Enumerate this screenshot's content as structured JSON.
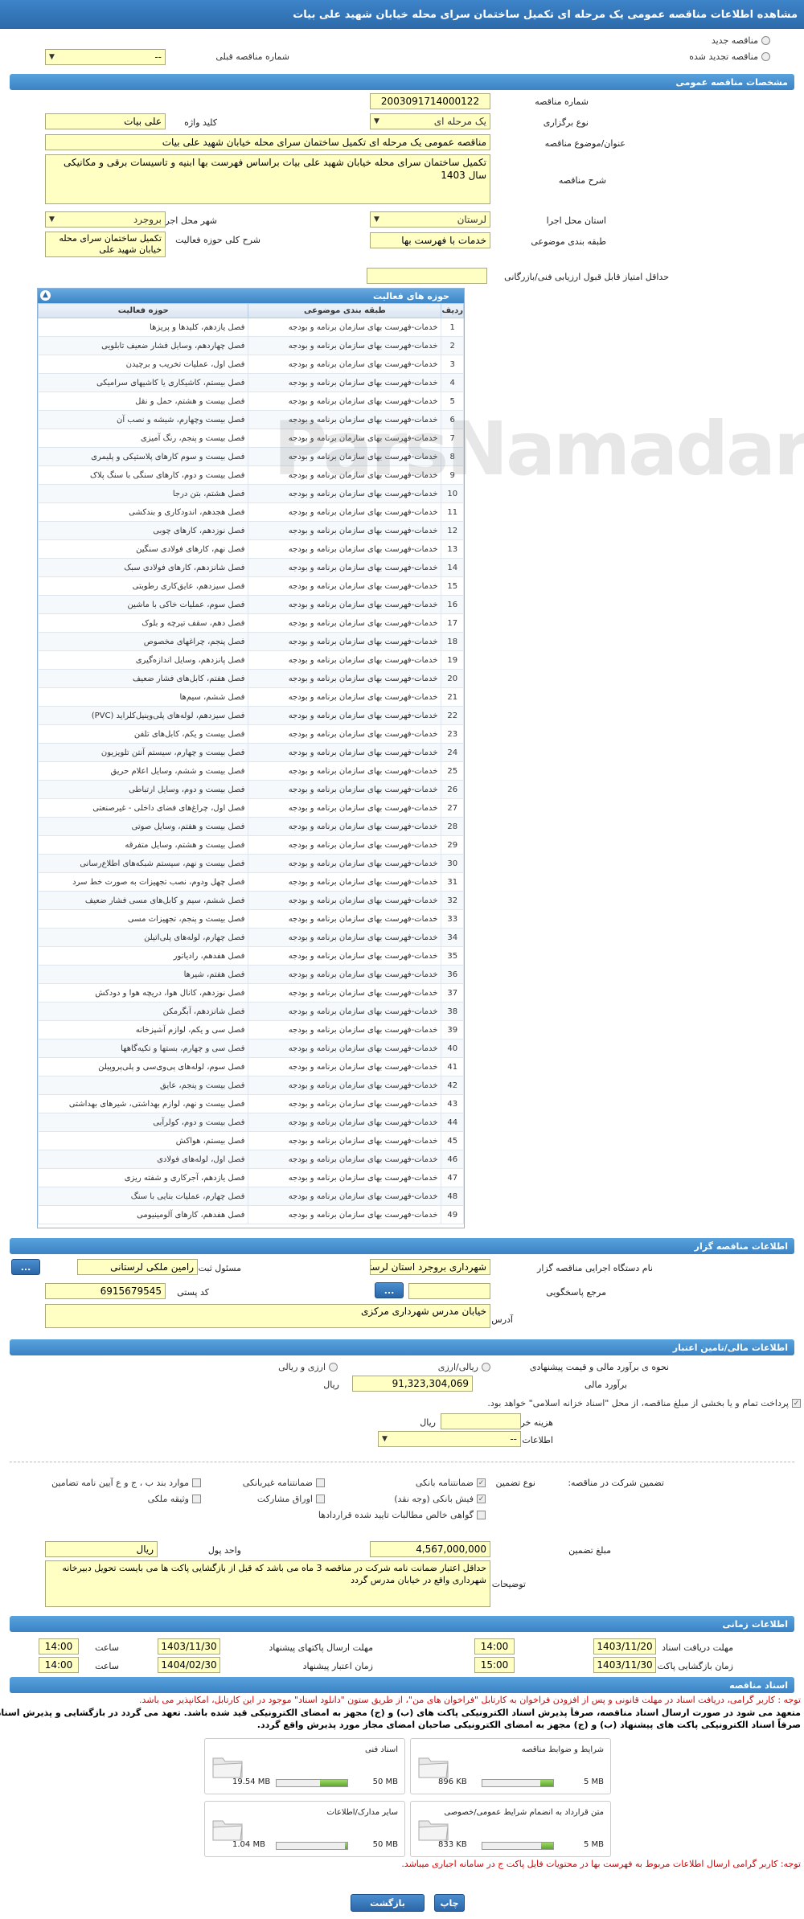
{
  "title": "مشاهده اطلاعات مناقصه عمومی یک مرحله ای تکمیل ساختمان سرای محله خیابان شهید علی بیات",
  "top": {
    "new_tender": "مناقصه جدید",
    "renewed_tender": "مناقصه تجدید شده",
    "previous_tender_label": "شماره مناقصه قبلی",
    "previous_tender_value": "--"
  },
  "sections": {
    "general": "مشخصات مناقصه عمومی",
    "organizer": "اطلاعات مناقصه گزار",
    "financial": "اطلاعات مالی/تامین اعتبار",
    "timing": "اطلاعات زمانی",
    "documents": "اسناد مناقصه"
  },
  "general": {
    "tender_number_label": "شماره مناقصه",
    "tender_number": "2003091714000122",
    "holding_type_label": "نوع برگزاری",
    "holding_type": "یک مرحله ای",
    "keyword_label": "کلید واژه",
    "keyword": "علی بیات",
    "subject_label": "عنوان/موضوع مناقصه",
    "subject": "مناقصه عمومی یک مرحله ای تکمیل ساختمان سرای محله خیابان شهید علی بیات",
    "description_label": "شرح مناقصه",
    "description": "تکمیل ساختمان سرای محله خیابان شهید علی بیات  براساس فهرست بها ابنیه و تاسیسات برقی و مکانیکی سال 1403",
    "province_label": "استان محل اجرا",
    "province": "لرستان",
    "city_label": "شهر محل اجرا",
    "city": "بروجرد",
    "category_label": "طبقه بندی موضوعی",
    "category": "خدمات با فهرست بها",
    "activity_desc_label": "شرح کلی حوزه فعالیت",
    "activity_desc": "تکمیل ساختمان سرای محله خیابان شهید علی",
    "min_score_label": "حداقل امتیاز قابل قبول ارزیابی فنی/بازرگانی",
    "min_score": ""
  },
  "activities": {
    "panel_title": "حوزه های فعالیت",
    "col_row": "ردیف",
    "col_category": "طبقه بندی موضوعی",
    "col_area": "حوزه فعالیت",
    "category_text": "خدمات-فهرست بهای سازمان برنامه و بودجه",
    "rows": [
      "فصل یازدهم، کلیدها و پریزها",
      "فصل چهاردهم، وسایل فشار ضعیف تابلویی",
      "فصل اول، عملیات تخریب و برچیدن",
      "فصل بیستم، کاشیکاری یا کاشیهای سرامیکی",
      "فصل بیست و هشتم، حمل و نقل",
      "فصل بیست وچهارم، شیشه و نصب آن",
      "فصل بیست و پنجم، رنگ آمیزی",
      "فصل بیست و سوم کارهای پلاستیکی و پلیمری",
      "فصل بیست و دوم، کارهای سنگی با سنگ پلاک",
      "فصل هشتم، بتن درجا",
      "فصل هجدهم، اندودکاری و بندکشی",
      "فصل نوزدهم، کارهای چوبی",
      "فصل نهم، کارهای فولادی سنگین",
      "فصل شانزدهم، کارهای فولادی سبک",
      "فصل سیزدهم، عایق‌کاری رطوبتی",
      "فصل سوم، عملیات خاکی با ماشین",
      "فصل دهم، سقف تیرچه و بلوک",
      "فصل پنجم، چراغهای مخصوص",
      "فصل پانزدهم، وسایل اندازه‌گیری",
      "فصل هفتم، کابل‌های فشار ضعیف",
      "فصل ششم، سیم‌ها",
      "فصل سیزدهم، لوله‌های پلی‌وینیل‌کلراید (PVC)",
      "فصل بیست و یکم، کابل‌های تلفن",
      "فصل بیست و چهارم، سیستم آنتن تلویزیون",
      "فصل بیست و ششم، وسایل اعلام حریق",
      "فصل بیست و دوم، وسایل ارتباطی",
      "فصل اول، چراغ‌های فضای داخلی - غیرصنعتی",
      "فصل بیست و هفتم، وسایل صوتی",
      "فصل بیست و هشتم، وسایل متفرقه",
      "فصل بیست و نهم، سیستم شبکه‌های اطلاع‌رسانی",
      "فصل چهل ودوم، نصب تجهیزات به صورت خط سرد",
      "فصل ششم، سیم و کابل‌های مسی فشار ضعیف",
      "فصل بیست و پنجم، تجهیزات مسی",
      "فصل چهارم، لوله‌های پلی‌اتیلن",
      "فصل هفدهم، رادیاتور",
      "فصل هفتم، شیرها",
      "فصل نوزدهم، کانال هوا، دریچه هوا و دودکش",
      "فصل شانزدهم، آبگرمکن",
      "فصل سی و یکم، لوازم آشپزخانه",
      "فصل سی و چهارم، بستها و تکیه‌گاهها",
      "فصل سوم، لوله‌های پی‌وی‌سی و پلی‌پروپیلن",
      "فصل بیست و پنجم، عایق",
      "فصل بیست و نهم، لوازم بهداشتی، شیرهای بهداشتی",
      "فصل بیست و دوم، کولرآبی",
      "فصل بیستم، هواکش",
      "فصل اول، لوله‌های فولادی",
      "فصل یازدهم، آجرکاری و شفته ریزی",
      "فصل چهارم، عملیات بنایی با سنگ",
      "فصل هفدهم، کارهای آلومینیومی"
    ]
  },
  "organizer": {
    "org_label": "نام دستگاه اجرایی مناقصه گزار",
    "org_value": "شهرداری بروجرد استان لرستان",
    "responsible_label": "مسئول ثبت مناقصه",
    "responsible_value": "رامین ملکی لرستانی",
    "reference_label": "مرجع پاسخگویی",
    "reference_value": "",
    "postal_label": "کد پستی",
    "postal_value": "6915679545",
    "address_label": "آدرس",
    "address_value": "خیابان مدرس شهرداری مرکزی",
    "dots": "..."
  },
  "financial": {
    "estimate_type_label": "نحوه ی برآورد مالی و قیمت پیشنهادی",
    "rial_label": "ریالی/ارزی",
    "currency_rial_label": "ارزی و ریالی",
    "estimate_label": "برآورد مالی",
    "estimate_value": "91,323,304,069",
    "estimate_unit": "ریال",
    "treasury_note": "پرداخت تمام و یا بخشی از مبلغ مناقصه، از محل \"اسناد خزانه اسلامی\" خواهد بود.",
    "doc_fee_label": "هزینه خرید اسناد",
    "doc_fee_value": "",
    "doc_fee_unit": "ریال",
    "account_label": "اطلاعات حساب جهت واریز هزینه خرید اسناد",
    "account_value": "--"
  },
  "guarantee": {
    "type_label": "نوع تضمین",
    "participation_label": "تضمین شرکت در مناقصه:",
    "bank_guarantee": "ضمانتنامه بانکی",
    "non_bank_guarantee": "ضمانتنامه غیربانکی",
    "clauses": "موارد بند ب ، ج و ع آیین نامه تضامین",
    "bank_receipt": "فیش بانکی (وجه نقد)",
    "bonds": "اوراق مشارکت",
    "property": "وثیقه ملکی",
    "net_claims": "گواهی خالص مطالبات تایید شده قراردادها",
    "amount_label": "مبلغ تضمین",
    "amount_value": "4,567,000,000",
    "unit_label": "واحد پول",
    "unit_value": "ریال",
    "notes_label": "توضیحات",
    "notes_value": "حداقل اعتبار ضمانت نامه شرکت در مناقصه 3 ماه می باشد که قبل از بازگشایی پاکت ها می بایست تحویل دبیرخانه شهرداری واقع در خیابان مدرس گردد"
  },
  "timing": {
    "receive_deadline_label": "مهلت دریافت اسناد",
    "receive_date": "1403/11/20",
    "receive_time": "14:00",
    "send_deadline_label": "مهلت ارسال پاکتهای پیشنهاد",
    "send_date": "1403/11/30",
    "send_time": "14:00",
    "open_label": "زمان بازگشایی پاکت ها",
    "open_date": "1403/11/30",
    "open_time": "15:00",
    "validity_label": "زمان اعتبار پیشنهاد",
    "validity_date": "1404/02/30",
    "validity_time": "14:00",
    "time_label": "ساعت"
  },
  "documents": {
    "note1": "توجه : کاربر گرامی، دریافت اسناد در مهلت قانونی و پس از افزودن فراخوان به کارتابل \"فراخوان های من\"، از طریق ستون \"دانلود اسناد\" موجود در این کارتابل، امکانپذیر می باشد.",
    "note2": "متعهد می شود در صورت ارسال اسناد مناقصه، صرفاً پذیرش اسناد الکترونیکی پاکت های (ب) و (ج) مجهز به امضای الکترونیکی قید شده باشد. تعهد می گردد در بازگشایی و پذیرش اسناد،",
    "note3": "صرفاً اسناد الکترونیکی پاکت های پیشنهاد (ب) و (ج) مجهز به امضای الکترونیکی صاحبان امضای مجاز مورد پذیرش واقع گردد.",
    "files": [
      {
        "name": "شرایط و ضوابط مناقصه",
        "size": "896 KB",
        "max": "5 MB",
        "fill": 0.18
      },
      {
        "name": "اسناد فنی",
        "size": "19.54 MB",
        "max": "50 MB",
        "fill": 0.39
      },
      {
        "name": "متن قرارداد به انضمام شرایط عمومی/خصوصی",
        "size": "833 KB",
        "max": "5 MB",
        "fill": 0.17
      },
      {
        "name": "سایر مدارک/اطلاعات",
        "size": "1.04 MB",
        "max": "50 MB",
        "fill": 0.03
      }
    ],
    "bottom_note": "توجه: کاربر گرامی ارسال اطلاعات مربوط به فهرست بها در محتویات فایل پاکت ج در سامانه اجباری میباشد."
  },
  "buttons": {
    "back": "بازگشت",
    "print": "چاپ"
  }
}
